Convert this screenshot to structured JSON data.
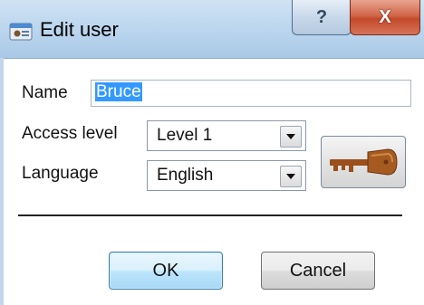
{
  "window": {
    "title": "Edit user",
    "help_label": "?",
    "close_label": "X"
  },
  "form": {
    "name_label": "Name",
    "name_value": "Bruce",
    "access_label": "Access level",
    "access_value": "Level 1",
    "language_label": "Language",
    "language_value": "English"
  },
  "buttons": {
    "ok_label": "OK",
    "cancel_label": "Cancel"
  },
  "icons": {
    "title_icon": "user-card-icon",
    "key_icon": "key-icon",
    "dropdown_icon": "chevron-down-icon"
  },
  "colors": {
    "accent": "#3399ff",
    "close_button": "#c34a2a",
    "key": "#a0521a"
  }
}
